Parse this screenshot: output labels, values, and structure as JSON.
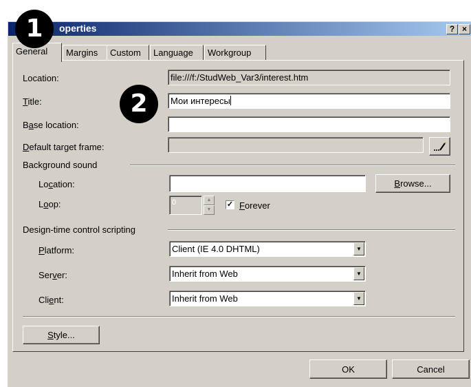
{
  "window": {
    "title": "operties",
    "help_label": "?",
    "close_label": "×"
  },
  "badges": {
    "one": "1",
    "two": "2"
  },
  "tabs": [
    {
      "label": "General",
      "active": true
    },
    {
      "label": "Margins"
    },
    {
      "label": "Custom"
    },
    {
      "label": "Language"
    },
    {
      "label": "Workgroup"
    }
  ],
  "general": {
    "location_label": "Location:",
    "location_value": "file:///f:/StudWeb_Var3/interest.htm",
    "title_label_u": "T",
    "title_label_rest": "itle:",
    "title_value": "Мои интересы",
    "base_label_pre": "B",
    "base_label_u": "a",
    "base_label_rest": "se location:",
    "base_value": "",
    "target_label_u": "D",
    "target_label_rest": "efault target frame:",
    "target_value": "",
    "target_button": "...",
    "bg_sound_heading": "Background sound",
    "sound_location_pre": "Lo",
    "sound_location_u": "c",
    "sound_location_rest": "ation:",
    "sound_location_value": "",
    "browse_u": "B",
    "browse_rest": "rowse...",
    "loop_pre": "L",
    "loop_u": "o",
    "loop_rest": "op:",
    "loop_value": "0",
    "forever_checked": "✓",
    "forever_u": "F",
    "forever_rest": "orever",
    "scripting_heading": "Design-time control scripting",
    "platform_u": "P",
    "platform_rest": "latform:",
    "platform_value": "Client (IE 4.0 DHTML)",
    "server_pre": "Ser",
    "server_u": "v",
    "server_rest": "er:",
    "server_value": "Inherit from Web",
    "client_pre": "Cli",
    "client_u": "e",
    "client_rest": "nt:",
    "client_value": "Inherit from Web",
    "style_u": "S",
    "style_rest": "tyle..."
  },
  "footer": {
    "ok": "OK",
    "cancel": "Cancel"
  },
  "icons": {
    "dropdown": "▼",
    "spin_up": "▲",
    "spin_down": "▼"
  }
}
